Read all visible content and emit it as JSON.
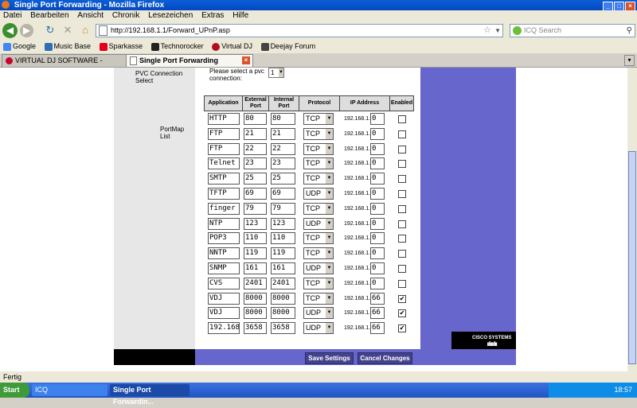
{
  "window": {
    "title": "Single Port Forwarding - Mozilla Firefox"
  },
  "menu": [
    "Datei",
    "Bearbeiten",
    "Ansicht",
    "Chronik",
    "Lesezeichen",
    "Extras",
    "Hilfe"
  ],
  "nav": {
    "url": "http://192.168.1.1/Forward_UPnP.asp",
    "search_placeholder": "ICQ Search"
  },
  "bookmarks": [
    {
      "label": "Google",
      "color": "#4285f4"
    },
    {
      "label": "Music Base",
      "color": "#2e6fb3"
    },
    {
      "label": "Sparkasse",
      "color": "#e2001a"
    },
    {
      "label": "Technorocker",
      "color": "#222222"
    },
    {
      "label": "Virtual DJ",
      "color": "#b0101e"
    },
    {
      "label": "Deejay Forum",
      "color": "#444444"
    }
  ],
  "tabs": [
    {
      "label": "VIRTUAL DJ SOFTWARE - problem mit ...",
      "active": false
    },
    {
      "label": "Single Port Forwarding",
      "active": true
    }
  ],
  "page": {
    "pvc_label": "PVC Connection Select",
    "pvc_select_text": "Please select a pvc connection:",
    "pvc_value": "1",
    "portmap_label": "PortMap List",
    "headers": [
      "Application",
      "External Port",
      "Internal Port",
      "Protocol",
      "IP Address",
      "Enabled"
    ],
    "ip_prefix": "192.168.1.",
    "rows": [
      {
        "app": "HTTP",
        "ext": "80",
        "int": "80",
        "proto": "TCP",
        "ip": "0",
        "enabled": false
      },
      {
        "app": "FTP",
        "ext": "21",
        "int": "21",
        "proto": "TCP",
        "ip": "0",
        "enabled": false
      },
      {
        "app": "FTP",
        "ext": "22",
        "int": "22",
        "proto": "TCP",
        "ip": "0",
        "enabled": false
      },
      {
        "app": "Telnet",
        "ext": "23",
        "int": "23",
        "proto": "TCP",
        "ip": "0",
        "enabled": false
      },
      {
        "app": "SMTP",
        "ext": "25",
        "int": "25",
        "proto": "TCP",
        "ip": "0",
        "enabled": false
      },
      {
        "app": "TFTP",
        "ext": "69",
        "int": "69",
        "proto": "UDP",
        "ip": "0",
        "enabled": false
      },
      {
        "app": "finger",
        "ext": "79",
        "int": "79",
        "proto": "TCP",
        "ip": "0",
        "enabled": false
      },
      {
        "app": "NTP",
        "ext": "123",
        "int": "123",
        "proto": "UDP",
        "ip": "0",
        "enabled": false
      },
      {
        "app": "POP3",
        "ext": "110",
        "int": "110",
        "proto": "TCP",
        "ip": "0",
        "enabled": false
      },
      {
        "app": "NNTP",
        "ext": "119",
        "int": "119",
        "proto": "TCP",
        "ip": "0",
        "enabled": false
      },
      {
        "app": "SNMP",
        "ext": "161",
        "int": "161",
        "proto": "UDP",
        "ip": "0",
        "enabled": false
      },
      {
        "app": "CVS",
        "ext": "2401",
        "int": "2401",
        "proto": "TCP",
        "ip": "0",
        "enabled": false
      },
      {
        "app": "VDJ",
        "ext": "8000",
        "int": "8000",
        "proto": "TCP",
        "ip": "66",
        "enabled": true
      },
      {
        "app": "VDJ",
        "ext": "8000",
        "int": "8000",
        "proto": "UDP",
        "ip": "66",
        "enabled": true
      },
      {
        "app": "192.168",
        "ext": "3658",
        "int": "3658",
        "proto": "UDP",
        "ip": "66",
        "enabled": true
      }
    ],
    "save_label": "Save Settings",
    "cancel_label": "Cancel Changes",
    "brand": "CISCO SYSTEMS"
  },
  "status": {
    "text": "Fertig"
  },
  "taskbar": {
    "start": "Start",
    "tasks": [
      "ICQ",
      "Single Port Forwardin..."
    ],
    "clock": "18:57"
  }
}
